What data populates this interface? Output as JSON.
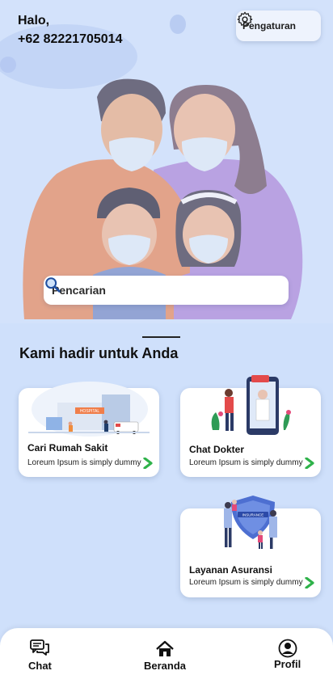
{
  "header": {
    "greeting": "Halo,",
    "phone": "+62 82221705014",
    "settings_label": "Pengaturan",
    "settings_icon": "gear-icon"
  },
  "search": {
    "placeholder": "Pencarian",
    "icon": "search-icon"
  },
  "section": {
    "title": "Kami hadir untuk Anda"
  },
  "cards": [
    {
      "title": "Cari Rumah Sakit",
      "desc": "Loreum Ipsum is simply dummy",
      "sign": "HOSPITAL"
    },
    {
      "title": "Chat Dokter",
      "desc": "Loreum Ipsum is simply dummy"
    },
    {
      "title": "Layanan Asuransi",
      "desc": "Loreum Ipsum is simply dummy",
      "badge": "INSURANCE"
    }
  ],
  "nav": {
    "chat": "Chat",
    "home": "Beranda",
    "profile": "Profil"
  },
  "colors": {
    "background": "#cfe0fb",
    "accent_green": "#2fb24a",
    "hero_orange": "#e89a7c",
    "hero_purple": "#b59ae0"
  }
}
